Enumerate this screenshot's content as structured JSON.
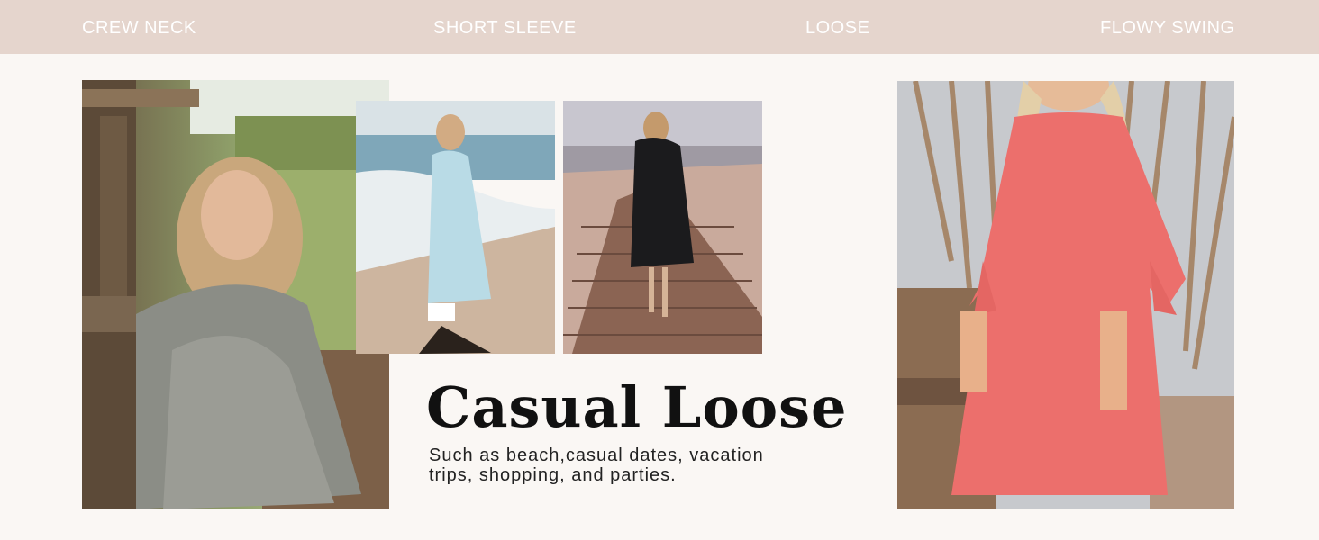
{
  "features": {
    "crew_neck": "CREW NECK",
    "short_sleeve": "SHORT SLEEVE",
    "loose": "LOOSE",
    "flowy_swing": "FLOWY SWING"
  },
  "headline": "Casual Loose",
  "subline": "Such as beach,casual dates, vacation trips, shopping, and parties.",
  "colors": {
    "feature_bar": "#e5d5cd",
    "page_background": "#faf7f4",
    "headline_text": "#111111"
  }
}
